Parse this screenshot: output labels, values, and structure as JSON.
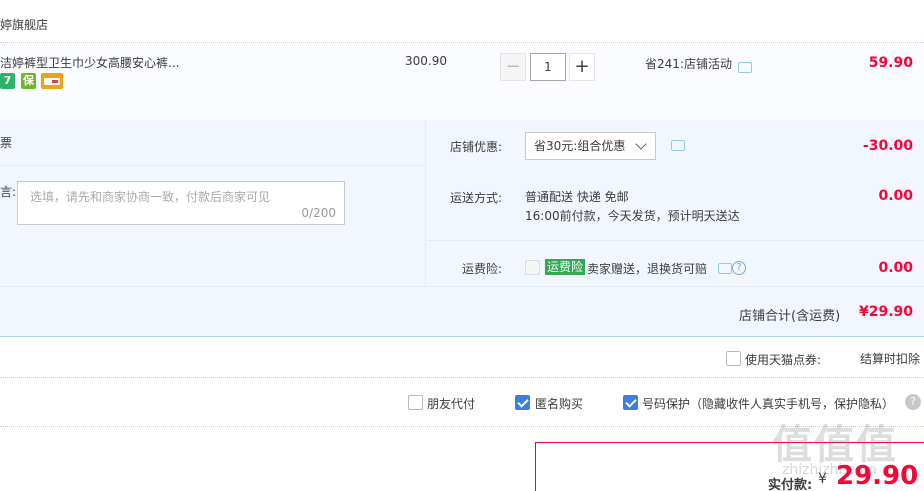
{
  "store": {
    "name": "婷旗舰店"
  },
  "item": {
    "title": "洁婷裤型卫生巾少女高腰安心裤...",
    "badges": [
      {
        "icon": "seven-day-return-icon",
        "text": "7",
        "color": "#2cb36b"
      },
      {
        "icon": "guarantee-icon",
        "text": "保",
        "color": "#6fb52c"
      },
      {
        "icon": "credit-card-icon",
        "text": "",
        "color": "#f0a21b"
      }
    ],
    "unit_price": "300.90",
    "quantity": "1",
    "minus_label": "−",
    "plus_label": "+",
    "discount": "省241:店铺活动",
    "subtotal": "59.90"
  },
  "invoice": {
    "label": "票"
  },
  "message": {
    "label": "言:",
    "placeholder": "选填，请先和商家协商一致，付款后商家可见",
    "counter": "0/200"
  },
  "store_discount": {
    "label": "店铺优惠:",
    "selected": "省30元:组合优惠",
    "amount": "-30.00"
  },
  "shipping": {
    "label": "运送方式:",
    "line1": "普通配送 快递 免邮",
    "line2": "16:00前付款，今天发货，预计明天送达",
    "amount": "0.00"
  },
  "insurance": {
    "label": "运费险:",
    "tag": "运费险",
    "text": "卖家赠送，退换货可赔",
    "amount": "0.00"
  },
  "store_total": {
    "label": "店铺合计(含运费)",
    "amount": "¥29.90"
  },
  "tmall_points": {
    "label": "使用天猫点券:",
    "note": "结算时扣除"
  },
  "options": {
    "friend_pay": "朋友代付",
    "anonymous": "匿名购买",
    "number_protect": "号码保护（隐藏收件人真实手机号，保护隐私）"
  },
  "payment": {
    "label": "实付款:",
    "currency": "¥",
    "amount": "29.90"
  },
  "watermark": {
    "text": "值值值",
    "sub": "zhizhizhi.com"
  },
  "colors": {
    "accent_red": "#ff0036",
    "accent_blue": "#3b7ee6",
    "panel_bg": "#f2f7ff"
  }
}
